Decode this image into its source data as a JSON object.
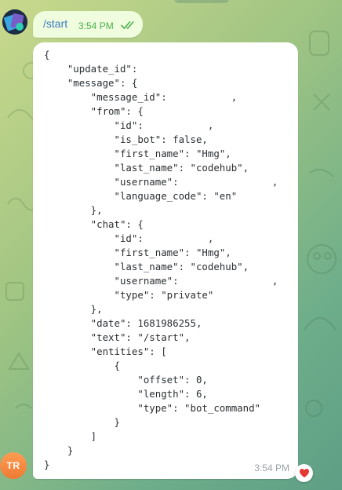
{
  "chat": {
    "outgoing": {
      "text": "/start",
      "time": "3:54 PM",
      "status_icon": "double-check-icon"
    },
    "incoming": {
      "json_text": "{\n    \"update_id\":\n    \"message\": {\n        \"message_id\":           ,\n        \"from\": {\n            \"id\":           ,\n            \"is_bot\": false,\n            \"first_name\": \"Hmg\",\n            \"last_name\": \"codehub\",\n            \"username\":                ,\n            \"language_code\": \"en\"\n        },\n        \"chat\": {\n            \"id\":           ,\n            \"first_name\": \"Hmg\",\n            \"last_name\": \"codehub\",\n            \"username\":                ,\n            \"type\": \"private\"\n        },\n        \"date\": 1681986255,\n        \"text\": \"/start\",\n        \"entities\": [\n            {\n                \"offset\": 0,\n                \"length\": 6,\n                \"type\": \"bot_command\"\n            }\n        ]\n    }\n}",
      "time": "3:54 PM",
      "reaction_icon": "heart-icon",
      "sender_initials": "TR"
    }
  },
  "colors": {
    "outgoing_bubble": "#effdde",
    "outgoing_text": "#3d79c2",
    "outgoing_time": "#4fae4e",
    "incoming_bubble": "#ffffff",
    "avatar_user": "#f08a3e",
    "reaction_heart": "#e53935"
  }
}
